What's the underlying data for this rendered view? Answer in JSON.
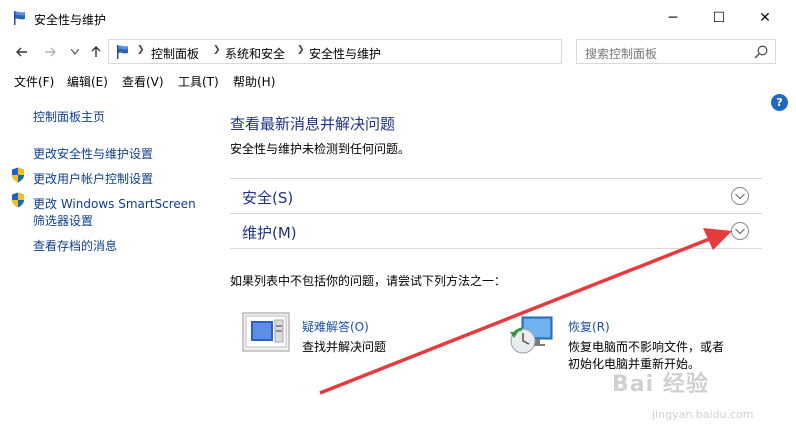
{
  "window": {
    "title": "安全性与维护",
    "minimize": "─",
    "maximize": "☐",
    "close": "✕"
  },
  "address": {
    "breadcrumbs": [
      "控制面板",
      "系统和安全",
      "安全性与维护"
    ],
    "search_placeholder": "搜索控制面板"
  },
  "menu": [
    "文件(F)",
    "编辑(E)",
    "查看(V)",
    "工具(T)",
    "帮助(H)"
  ],
  "help_label": "?",
  "sidebar": {
    "home": "控制面板主页",
    "link_security_settings": "更改安全性与维护设置",
    "link_uac": "更改用户帐户控制设置",
    "link_smartscreen_1": "更改 Windows SmartScreen",
    "link_smartscreen_2": "筛选器设置",
    "link_archived": "查看存档的消息"
  },
  "main": {
    "title": "查看最新消息并解决问题",
    "subtitle": "安全性与维护未检测到任何问题。",
    "sections": [
      "安全(S)",
      "维护(M)"
    ],
    "hint": "如果列表中不包括你的问题，请尝试下列方法之一：",
    "troubleshoot_title": "疑难解答(O)",
    "troubleshoot_desc": "查找并解决问题",
    "recovery_title": "恢复(R)",
    "recovery_desc_1": "恢复电脑而不影响文件，或者",
    "recovery_desc_2": "初始化电脑并重新开始。"
  },
  "watermark": {
    "text": "Bai 经验",
    "sub": "jingyan.baidu.com"
  },
  "colors": {
    "link": "#0f3f8c",
    "heading": "#1e3287",
    "annotation_arrow": "#e8393c"
  }
}
